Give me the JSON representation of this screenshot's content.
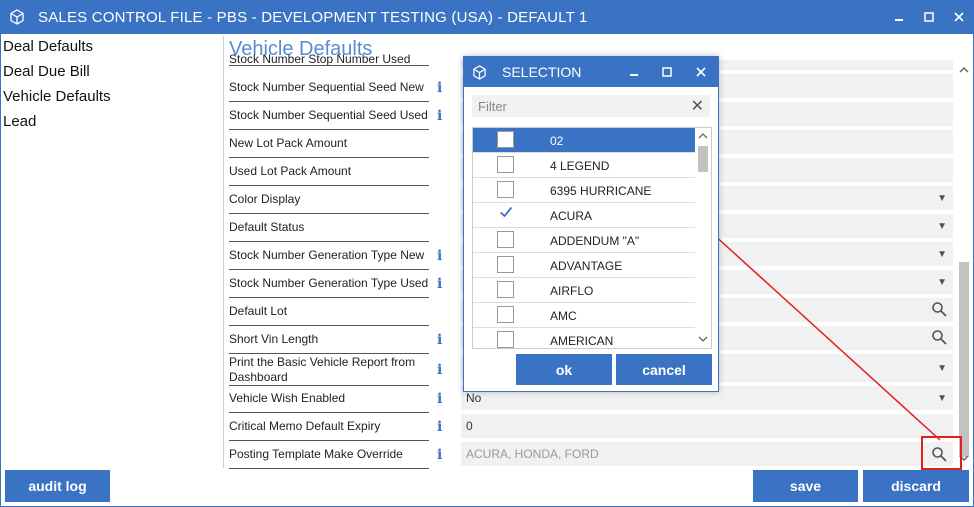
{
  "window": {
    "title": "SALES CONTROL FILE - PBS - DEVELOPMENT TESTING (USA) - DEFAULT 1"
  },
  "nav": {
    "items": [
      "Deal Defaults",
      "Deal Due Bill",
      "Vehicle Defaults",
      "Lead"
    ]
  },
  "section": {
    "title": "Vehicle Defaults"
  },
  "rows": [
    {
      "label": "Stock Number Stop Number Used"
    },
    {
      "label": "Stock Number Sequential Seed New",
      "info": "i"
    },
    {
      "label": "Stock Number Sequential Seed Used",
      "info": "i"
    },
    {
      "label": "New Lot Pack Amount"
    },
    {
      "label": "Used Lot Pack Amount"
    },
    {
      "label": "Color Display"
    },
    {
      "label": "Default Status"
    },
    {
      "label": "Stock Number Generation Type New",
      "info": "i"
    },
    {
      "label": "Stock Number Generation Type Used",
      "info": "i"
    },
    {
      "label": "Default Lot"
    },
    {
      "label": "Short Vin Length",
      "info": "i"
    },
    {
      "label": "Print the Basic Vehicle Report from Dashboard",
      "info": "i"
    },
    {
      "label": "Vehicle Wish Enabled",
      "info": "i",
      "value": "No"
    },
    {
      "label": "Critical Memo Default Expiry",
      "info": "i",
      "value": "0"
    },
    {
      "label": "Posting Template Make Override",
      "info": "i",
      "value": "ACURA, HONDA, FORD"
    }
  ],
  "buttons": {
    "audit_log": "audit log",
    "save": "save",
    "discard": "discard"
  },
  "dialog": {
    "title": "SELECTION",
    "filter_placeholder": "Filter",
    "items": [
      {
        "label": "02",
        "checked": false,
        "selected": true
      },
      {
        "label": "4 LEGEND",
        "checked": false
      },
      {
        "label": "6395 HURRICANE",
        "checked": false
      },
      {
        "label": "ACURA",
        "checked": true
      },
      {
        "label": "ADDENDUM \"A\"",
        "checked": false
      },
      {
        "label": "ADVANTAGE",
        "checked": false
      },
      {
        "label": "AIRFLO",
        "checked": false
      },
      {
        "label": "AMC",
        "checked": false
      },
      {
        "label": "AMERICAN",
        "checked": false
      }
    ],
    "ok": "ok",
    "cancel": "cancel"
  },
  "colors": {
    "accent": "#3a73c4",
    "annotation": "#e02020"
  }
}
